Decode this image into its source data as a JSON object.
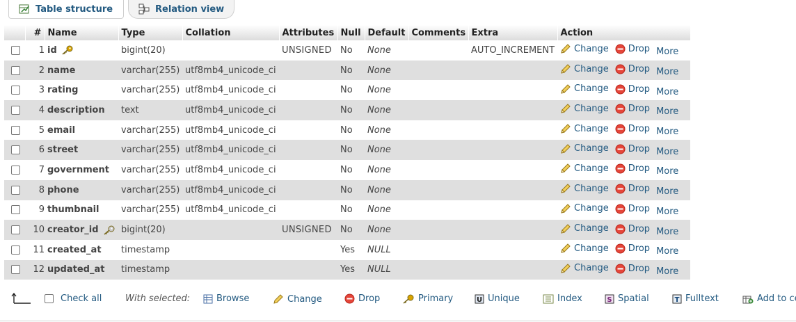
{
  "tabs": [
    {
      "label": "Table structure",
      "icon": "table-structure-icon"
    },
    {
      "label": "Relation view",
      "icon": "relation-view-icon"
    }
  ],
  "columns": [
    "#",
    "Name",
    "Type",
    "Collation",
    "Attributes",
    "Null",
    "Default",
    "Comments",
    "Extra",
    "Action"
  ],
  "rows": [
    {
      "num": "1",
      "name": "id",
      "key": "primary",
      "type": "bigint(20)",
      "collation": "",
      "attributes": "UNSIGNED",
      "null": "No",
      "default": "None",
      "comments": "",
      "extra": "AUTO_INCREMENT"
    },
    {
      "num": "2",
      "name": "name",
      "key": "",
      "type": "varchar(255)",
      "collation": "utf8mb4_unicode_ci",
      "attributes": "",
      "null": "No",
      "default": "None",
      "comments": "",
      "extra": ""
    },
    {
      "num": "3",
      "name": "rating",
      "key": "",
      "type": "varchar(255)",
      "collation": "utf8mb4_unicode_ci",
      "attributes": "",
      "null": "No",
      "default": "None",
      "comments": "",
      "extra": ""
    },
    {
      "num": "4",
      "name": "description",
      "key": "",
      "type": "text",
      "collation": "utf8mb4_unicode_ci",
      "attributes": "",
      "null": "No",
      "default": "None",
      "comments": "",
      "extra": ""
    },
    {
      "num": "5",
      "name": "email",
      "key": "",
      "type": "varchar(255)",
      "collation": "utf8mb4_unicode_ci",
      "attributes": "",
      "null": "No",
      "default": "None",
      "comments": "",
      "extra": ""
    },
    {
      "num": "6",
      "name": "street",
      "key": "",
      "type": "varchar(255)",
      "collation": "utf8mb4_unicode_ci",
      "attributes": "",
      "null": "No",
      "default": "None",
      "comments": "",
      "extra": ""
    },
    {
      "num": "7",
      "name": "government",
      "key": "",
      "type": "varchar(255)",
      "collation": "utf8mb4_unicode_ci",
      "attributes": "",
      "null": "No",
      "default": "None",
      "comments": "",
      "extra": ""
    },
    {
      "num": "8",
      "name": "phone",
      "key": "",
      "type": "varchar(255)",
      "collation": "utf8mb4_unicode_ci",
      "attributes": "",
      "null": "No",
      "default": "None",
      "comments": "",
      "extra": ""
    },
    {
      "num": "9",
      "name": "thumbnail",
      "key": "",
      "type": "varchar(255)",
      "collation": "utf8mb4_unicode_ci",
      "attributes": "",
      "null": "No",
      "default": "None",
      "comments": "",
      "extra": ""
    },
    {
      "num": "10",
      "name": "creator_id",
      "key": "index",
      "type": "bigint(20)",
      "collation": "",
      "attributes": "UNSIGNED",
      "null": "No",
      "default": "None",
      "comments": "",
      "extra": ""
    },
    {
      "num": "11",
      "name": "created_at",
      "key": "",
      "type": "timestamp",
      "collation": "",
      "attributes": "",
      "null": "Yes",
      "default": "NULL",
      "comments": "",
      "extra": ""
    },
    {
      "num": "12",
      "name": "updated_at",
      "key": "",
      "type": "timestamp",
      "collation": "",
      "attributes": "",
      "null": "Yes",
      "default": "NULL",
      "comments": "",
      "extra": ""
    }
  ],
  "row_actions": {
    "change": "Change",
    "drop": "Drop",
    "more": "More"
  },
  "footer": {
    "check_all": "Check all",
    "with_selected": "With selected:",
    "actions": [
      {
        "label": "Browse",
        "icon": "browse-icon"
      },
      {
        "label": "Change",
        "icon": "pencil-icon"
      },
      {
        "label": "Drop",
        "icon": "drop-icon"
      },
      {
        "label": "Primary",
        "icon": "primary-key-icon"
      },
      {
        "label": "Unique",
        "icon": "unique-icon"
      },
      {
        "label": "Index",
        "icon": "index-icon"
      },
      {
        "label": "Spatial",
        "icon": "spatial-icon"
      },
      {
        "label": "Fulltext",
        "icon": "fulltext-icon"
      },
      {
        "label": "Add to ce",
        "icon": "add-to-central-icon"
      }
    ]
  },
  "colors": {
    "link": "#235a81",
    "row_alt": "#dfdfdf",
    "drop_red": "#e5463a",
    "key_gold": "#d9a400"
  }
}
